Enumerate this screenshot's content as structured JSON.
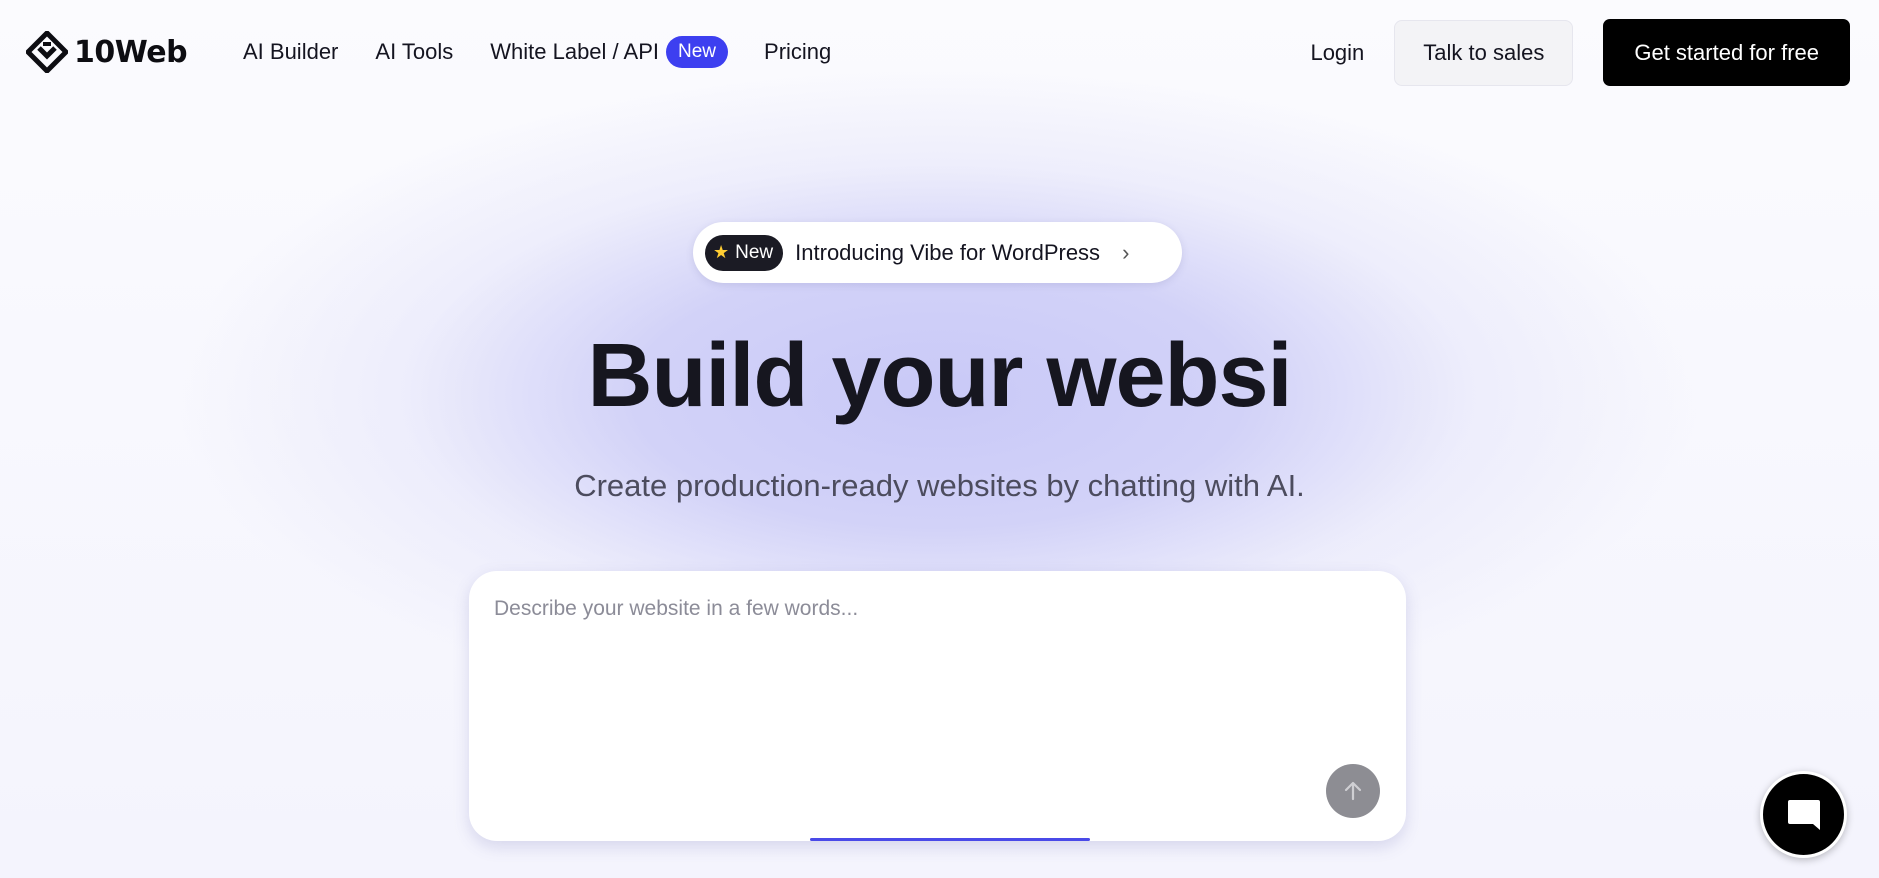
{
  "header": {
    "logo_text": "10Web",
    "nav": {
      "ai_builder": "AI Builder",
      "ai_tools": "AI Tools",
      "white_label": "White Label / API",
      "white_label_badge": "New",
      "pricing": "Pricing"
    },
    "login": "Login",
    "talk_to_sales": "Talk to sales",
    "get_started": "Get started for free"
  },
  "announcement": {
    "badge": "New",
    "badge_icon": "star-icon",
    "text": "Introducing Vibe for WordPress",
    "chevron": "›"
  },
  "hero": {
    "headline": "Build your websi",
    "subheadline": "Create production-ready websites by chatting with AI."
  },
  "prompt": {
    "placeholder": "Describe your website in a few words...",
    "value": "",
    "send_icon": "arrow-up-icon"
  },
  "chat_widget": {
    "icon": "chat-bubble-icon"
  },
  "colors": {
    "accent": "#3d3ff0",
    "primary_button": "#000000",
    "hero_glow": "#c9c9f7"
  }
}
